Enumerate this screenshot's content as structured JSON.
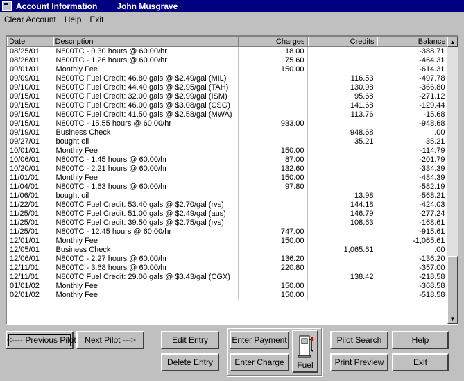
{
  "window": {
    "title": "Account Information",
    "user": "John Musgrave"
  },
  "menu": [
    "Clear Account",
    "Help",
    "Exit"
  ],
  "columns": [
    "Date",
    "Description",
    "Charges",
    "Credits",
    "Balance"
  ],
  "rows": [
    [
      "08/25/01",
      "N800TC - 0.30 hours @ 60.00/hr",
      "18.00",
      "",
      "-388.71"
    ],
    [
      "08/26/01",
      "N800TC - 1.26 hours @ 60.00/hr",
      "75.60",
      "",
      "-464.31"
    ],
    [
      "09/01/01",
      "Monthly Fee",
      "150.00",
      "",
      "-614.31"
    ],
    [
      "09/09/01",
      "N800TC Fuel Credit: 46.80 gals @ $2.49/gal (MIL)",
      "",
      "116.53",
      "-497.78"
    ],
    [
      "09/10/01",
      "N800TC Fuel Credit: 44.40 gals @ $2.95/gal (TAH)",
      "",
      "130.98",
      "-366.80"
    ],
    [
      "09/15/01",
      "N800TC Fuel Credit: 32.00 gals @ $2.99/gal (ISM)",
      "",
      "95.68",
      "-271.12"
    ],
    [
      "09/15/01",
      "N800TC Fuel Credit: 46.00 gals @ $3.08/gal (CSG)",
      "",
      "141.68",
      "-129.44"
    ],
    [
      "09/15/01",
      "N800TC Fuel Credit: 41.50 gals @ $2.58/gal (MWA)",
      "",
      "113.76",
      "-15.68"
    ],
    [
      "09/15/01",
      "N800TC - 15.55 hours @ 60.00/hr",
      "933.00",
      "",
      "-948.68"
    ],
    [
      "09/19/01",
      "Business Check",
      "",
      "948.68",
      ".00"
    ],
    [
      "09/27/01",
      "bought oil",
      "",
      "35.21",
      "35.21"
    ],
    [
      "10/01/01",
      "Monthly Fee",
      "150.00",
      "",
      "-114.79"
    ],
    [
      "10/06/01",
      "N800TC - 1.45 hours @ 60.00/hr",
      "87.00",
      "",
      "-201.79"
    ],
    [
      "10/20/01",
      "N800TC - 2.21 hours @ 60.00/hr",
      "132.60",
      "",
      "-334.39"
    ],
    [
      "11/01/01",
      "Monthly Fee",
      "150.00",
      "",
      "-484.39"
    ],
    [
      "11/04/01",
      "N800TC - 1.63 hours @ 60.00/hr",
      "97.80",
      "",
      "-582.19"
    ],
    [
      "11/06/01",
      "bought oil",
      "",
      "13.98",
      "-568.21"
    ],
    [
      "11/22/01",
      "N800TC Fuel Credit: 53.40 gals @ $2.70/gal (rvs)",
      "",
      "144.18",
      "-424.03"
    ],
    [
      "11/25/01",
      "N800TC Fuel Credit: 51.00 gals @ $2.49/gal (aus)",
      "",
      "146.79",
      "-277.24"
    ],
    [
      "11/25/01",
      "N800TC Fuel Credit: 39.50 gals @ $2.75/gal (rvs)",
      "",
      "108.63",
      "-168.61"
    ],
    [
      "11/25/01",
      "N800TC - 12.45 hours @ 60.00/hr",
      "747.00",
      "",
      "-915.61"
    ],
    [
      "12/01/01",
      "Monthly Fee",
      "150.00",
      "",
      "-1,065.61"
    ],
    [
      "12/05/01",
      "Business Check",
      "",
      "1,065.61",
      ".00"
    ],
    [
      "12/06/01",
      "N800TC - 2.27 hours @ 60.00/hr",
      "136.20",
      "",
      "-136.20"
    ],
    [
      "12/11/01",
      "N800TC - 3.68 hours @ 60.00/hr",
      "220.80",
      "",
      "-357.00"
    ],
    [
      "12/11/01",
      "N800TC Fuel Credit: 29.00 gals @ $3.43/gal (CGX)",
      "",
      "138.42",
      "-218.58"
    ],
    [
      "01/01/02",
      "Monthly Fee",
      "150.00",
      "",
      "-368.58"
    ],
    [
      "02/01/02",
      "Monthly Fee",
      "150.00",
      "",
      "-518.58"
    ]
  ],
  "buttons": {
    "prev_pilot": "<---- Previous Pilot",
    "next_pilot": "Next Pilot --->",
    "edit_entry": "Edit Entry",
    "delete_entry": "Delete Entry",
    "enter_payment": "Enter Payment",
    "enter_charge": "Enter Charge",
    "fuel": "Fuel",
    "pilot_search": "Pilot Search",
    "print_preview": "Print Preview",
    "help": "Help",
    "exit": "Exit"
  }
}
